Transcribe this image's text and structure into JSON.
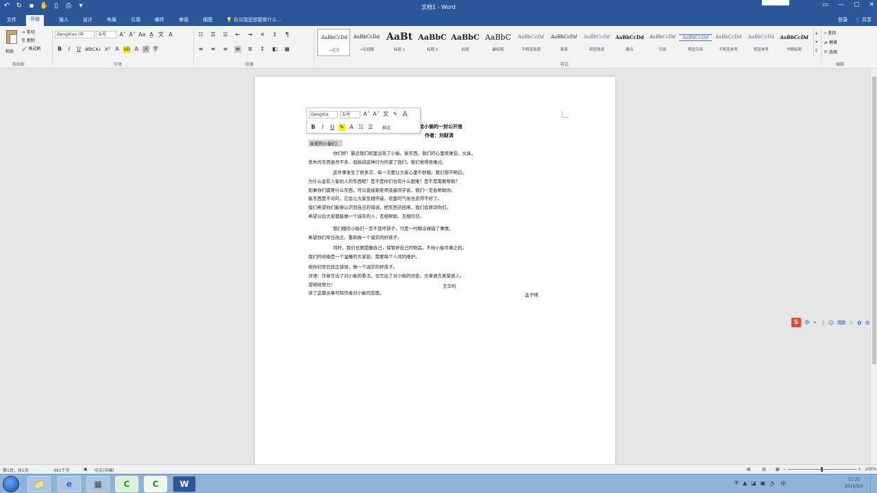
{
  "window": {
    "title": "文档1 - Word",
    "controls": {
      "ribbon_opts": "▭",
      "minimize": "—",
      "maximize": "▢",
      "close": "✕"
    }
  },
  "qat": {
    "undo": "↶",
    "redo": "↻",
    "save": "▪",
    "touch": "✋",
    "new": "▯",
    "print": "⎙",
    "more": "▾"
  },
  "tabs": {
    "items": [
      "文件",
      "开始",
      "插入",
      "设计",
      "布局",
      "引用",
      "邮件",
      "审阅",
      "视图"
    ],
    "active_index": 1,
    "tell_me": "告诉我您想要做什么...",
    "login": "登录",
    "share": "共享"
  },
  "ribbon": {
    "clipboard": {
      "paste": "粘贴",
      "cut": "剪切",
      "copy": "复制",
      "format_painter": "格式刷",
      "label": "剪贴板"
    },
    "font": {
      "family": "DengXian (中",
      "size": "五号",
      "label": "字体",
      "row1": [
        "A˄",
        "A˅",
        "Aa",
        "A̲",
        "文",
        "A"
      ],
      "row2": [
        "B",
        "I",
        "U",
        "abc",
        "x₂",
        "x²",
        "A",
        "ab",
        "A",
        "Ⓐ",
        "字"
      ]
    },
    "paragraph": {
      "label": "段落",
      "row1": [
        "☷",
        "☰",
        "☱",
        "⇤",
        "⇥",
        "✕",
        "↕",
        "¶"
      ],
      "row2": [
        "≡",
        "≡",
        "≡",
        "≡",
        "≣",
        "↕",
        "◧",
        "▦"
      ]
    },
    "styles": {
      "label": "样式",
      "items": [
        {
          "preview": "AaBbCcDd",
          "name": "→正文"
        },
        {
          "preview": "AaBbCcDd",
          "name": "→无间隔"
        },
        {
          "preview": "AaBt",
          "name": "标题 1"
        },
        {
          "preview": "AaBbC",
          "name": "标题 2"
        },
        {
          "preview": "AaBbC",
          "name": "标题"
        },
        {
          "preview": "AaBbC",
          "name": "副标题"
        },
        {
          "preview": "AaBbCcDd",
          "name": "不明显强调"
        },
        {
          "preview": "AaBbCcDd",
          "name": "强调"
        },
        {
          "preview": "AaBbCcDd",
          "name": "明显强调"
        },
        {
          "preview": "AaBbCcDd",
          "name": "要点"
        },
        {
          "preview": "AaBbCcDd",
          "name": "引用"
        },
        {
          "preview": "AaBbCcDd",
          "name": "明显引用"
        },
        {
          "preview": "AaBbCcDd",
          "name": "不明显参考"
        },
        {
          "preview": "AaBbCcDd",
          "name": "明显参考"
        },
        {
          "preview": "AaBbCcDd",
          "name": "书籍标题"
        }
      ],
      "selected_index": 0
    },
    "editing": {
      "find": "查找",
      "replace": "替换",
      "select": "选择",
      "label": "编辑"
    }
  },
  "mini_toolbar": {
    "font": "DengXia",
    "size": "五号",
    "row1": [
      "A˄",
      "A˅",
      "文",
      "✎",
      "A"
    ],
    "row2": [
      "B",
      "I",
      "U",
      "✎",
      "A",
      "☷",
      "☰",
      "样式"
    ]
  },
  "document": {
    "title": "给小偷的一封公开信",
    "author": "作者：刘财清",
    "greeting": "亲爱的小偷们：",
    "paragraphs": [
      [
        "你们好！最近我们班里出现了小偷。偷东西，我们的心里很难受。文具，",
        "丢失的东西虽然不多，但偷窃这种行为伤害了我们，我们觉得很难过。"
      ],
      [
        "这件事发生了很多次，每一次都让大家心里不舒服。我们想不明白，",
        "为什么会有人偷别人的东西呢？是不是你们也有什么困难？是不是需要帮助？",
        "如果你们需要什么东西，可以直接跟老师或者同学说，我们一定会帮助你。",
        "偷东西是不对的，它会让大家互相怀疑，班里的气氛也变得不好了。",
        "我们希望你们能够认识到自己的错误，把东西还回来，我们会原谅你们。",
        "希望以后大家都能做一个诚实的人，互相帮助，互相信任。"
      ],
      [
        "我们相信小偷们一定不是坏孩子，只是一时糊涂做错了事情。",
        "希望你们早日改正，重新做一个诚实的好孩子。"
      ],
      [
        "同时，我们也要提醒自己，保管好自己的物品，不给小偷可乘之机。",
        "我们的班级是一个温暖的大家庭，需要每个人共同维护。"
      ]
    ],
    "closing": "祝你们早日改正错误，做一个诚实的好孩子。",
    "review": "评语：作者写出了对小偷的看法，也写出了对小偷的劝告，文章语言真挚感人。",
    "wish": "望继续努力！",
    "teacher": "王华利",
    "final": "读了这篇文章可知作者对小偷的态度。",
    "signer": "孟子晴"
  },
  "statusbar": {
    "page": "第1页，共1页",
    "words": "491个字",
    "lang": "中文(中国)",
    "zoom": "100%",
    "zoom_value": 100
  },
  "ime": {
    "logo": "S",
    "icons": [
      "中",
      "•",
      "☽",
      "☺",
      "⌨",
      "♧",
      "✿",
      "⚙"
    ]
  },
  "taskbar": {
    "apps": [
      "📁",
      "e",
      "▦",
      "C",
      "C",
      "W"
    ],
    "tray": [
      "⛨",
      "▲",
      "◪",
      "▣",
      "🔊",
      "中"
    ],
    "time": "11:22",
    "date": "2016/5/3"
  }
}
